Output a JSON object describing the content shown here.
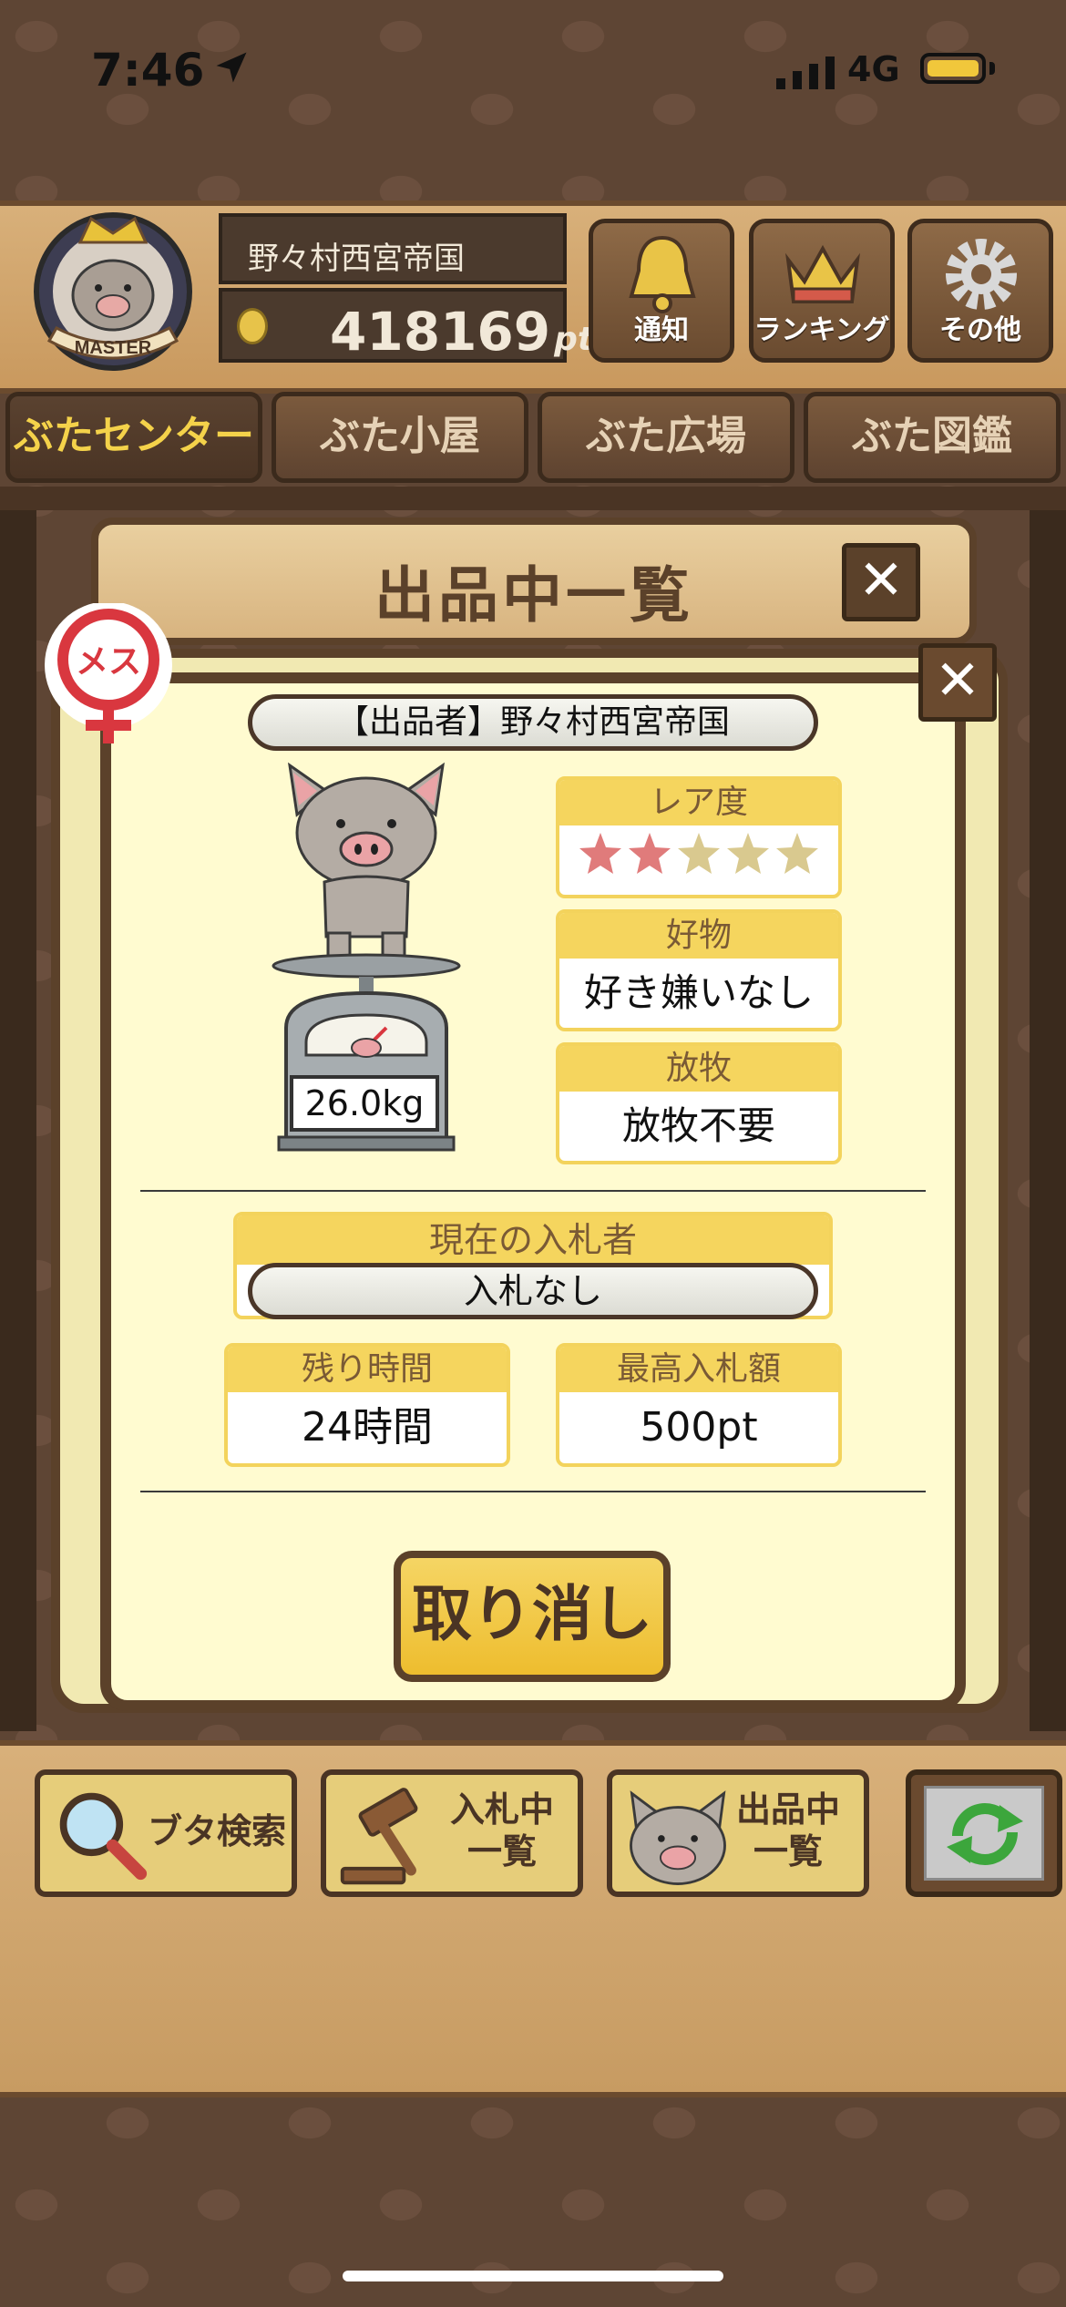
{
  "status_bar": {
    "time": "7:46",
    "network": "4G"
  },
  "header": {
    "badge_text": "MASTER",
    "player_name": "野々村西宮帝国",
    "points_value": "418169",
    "points_unit": "pt",
    "buttons": [
      {
        "label": "通知",
        "icon": "bell-icon"
      },
      {
        "label": "ランキング",
        "icon": "crown-icon"
      },
      {
        "label": "その他",
        "icon": "gear-icon"
      }
    ]
  },
  "tabs": [
    {
      "label": "ぶたセンター",
      "active": true
    },
    {
      "label": "ぶた小屋",
      "active": false
    },
    {
      "label": "ぶた広場",
      "active": false
    },
    {
      "label": "ぶた図鑑",
      "active": false
    }
  ],
  "panel": {
    "title": "出品中一覧"
  },
  "listing": {
    "gender_badge": "メス",
    "seller": "【出品者】野々村西宮帝国",
    "weight": "26.0kg",
    "rarity": {
      "label": "レア度",
      "stars_filled": 2,
      "stars_total": 5
    },
    "favorite_food": {
      "label": "好物",
      "value": "好き嫌いなし"
    },
    "grazing": {
      "label": "放牧",
      "value": "放牧不要"
    },
    "current_bidder": {
      "label": "現在の入札者",
      "value": "入札なし"
    },
    "time_left": {
      "label": "残り時間",
      "value": "24時間"
    },
    "highest_bid": {
      "label": "最高入札額",
      "value": "500pt"
    },
    "cancel_label": "取り消し"
  },
  "toolbar": {
    "search_label": "ブタ検索",
    "bidding_label_1": "入札中",
    "bidding_label_2": "一覧",
    "listing_label_1": "出品中",
    "listing_label_2": "一覧"
  },
  "colors": {
    "accent_yellow": "#f5d55e",
    "wood_dark": "#5b412a",
    "panel_cream": "#fffbd0",
    "star_pink": "#e07b7b",
    "star_empty": "#d9c98f"
  }
}
